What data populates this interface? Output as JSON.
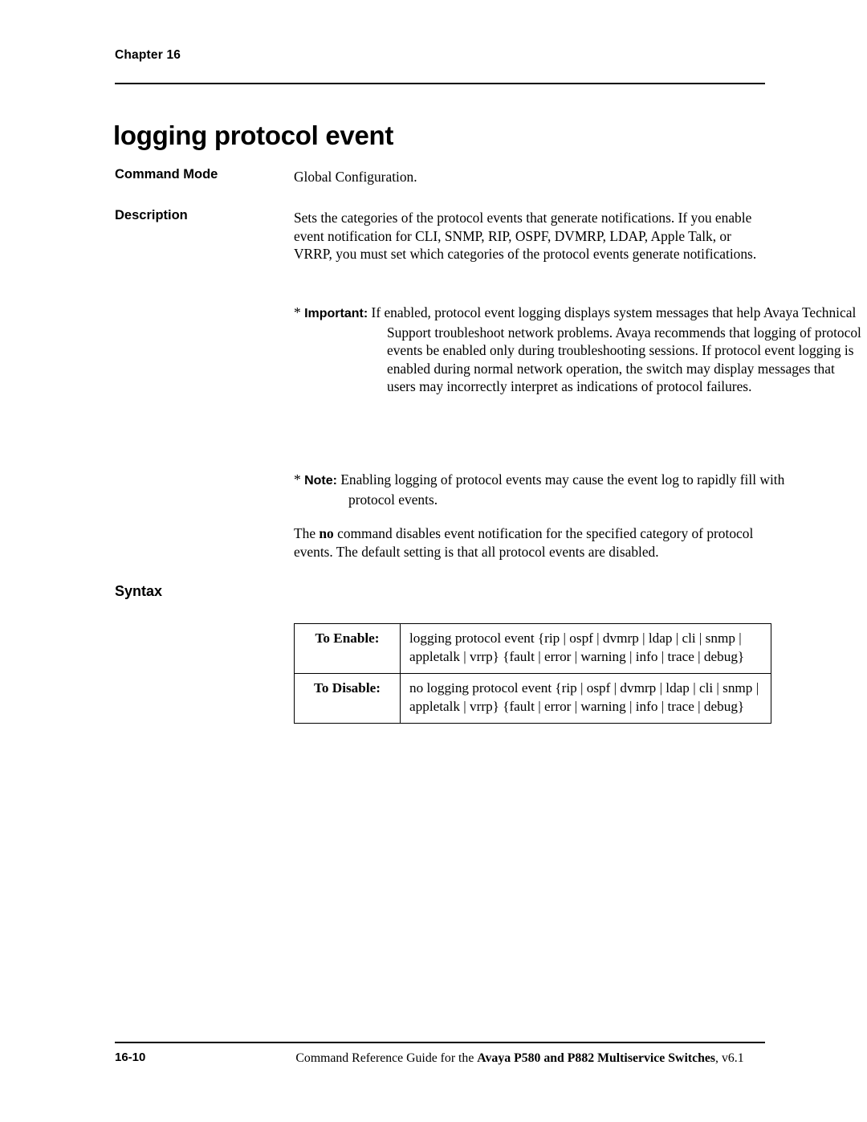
{
  "header": {
    "chapter": "Chapter 16"
  },
  "title": "logging protocol event",
  "labels": {
    "command_mode": "Command Mode",
    "description": "Description",
    "syntax": "Syntax"
  },
  "command_mode_text": "Global Configuration.",
  "description_text": "Sets the categories of the protocol events that generate notifications. If you enable event notification for CLI, SNMP, RIP, OSPF, DVMRP, LDAP, Apple Talk, or VRRP, you must set which categories of the protocol events generate notifications.",
  "important": {
    "star": "*",
    "head": "Important:",
    "text": "If enabled, protocol event logging displays system messages that help Avaya Technical Support troubleshoot network problems. Avaya recommends that logging of protocol events be enabled only during troubleshooting sessions. If protocol event logging is enabled during normal network operation, the switch may display messages that users may incorrectly interpret as indications of protocol failures."
  },
  "note": {
    "star": "*",
    "head": "Note:",
    "text": "Enabling logging of protocol events may cause the event log to rapidly fill with protocol events."
  },
  "no_command": {
    "prefix": "The ",
    "bold": "no",
    "suffix": " command disables event notification for the specified category of protocol events. The default setting is that all protocol events are disabled."
  },
  "syntax_table": {
    "rows": [
      {
        "key": "To Enable:",
        "value": "logging protocol event {rip | ospf | dvmrp | ldap | cli | snmp | appletalk | vrrp} {fault | error | warning | info | trace | debug}"
      },
      {
        "key": "To Disable:",
        "value": "no logging protocol event {rip | ospf | dvmrp | ldap | cli | snmp | appletalk | vrrp} {fault | error | warning | info | trace | debug}"
      }
    ]
  },
  "footer": {
    "page_number": "16-10",
    "text_prefix": "Command Reference Guide for the ",
    "text_bold": "Avaya P580 and P882 Multiservice Switches",
    "text_suffix": ", v6.1"
  }
}
